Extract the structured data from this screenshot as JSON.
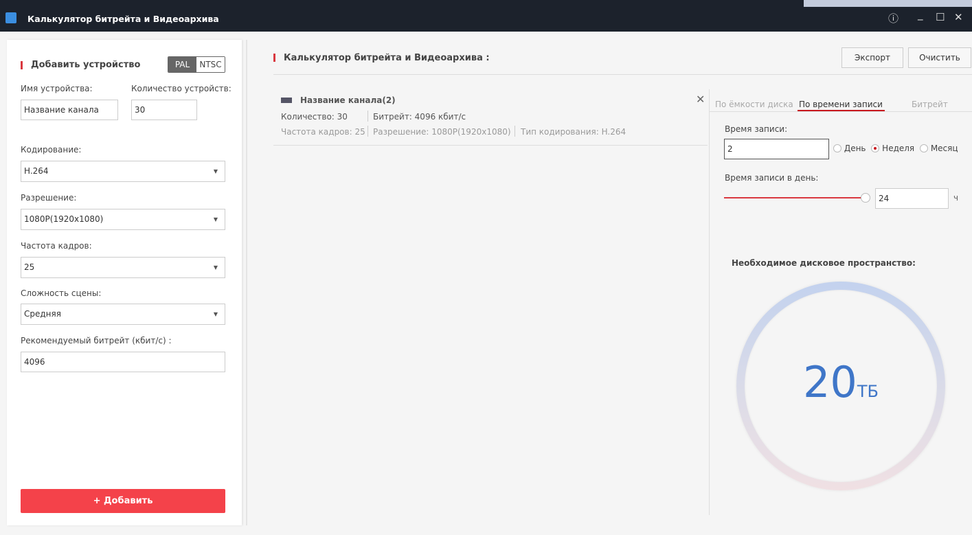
{
  "window": {
    "title": "Калькулятор битрейта и Видеоархива",
    "info_icon": "info-icon",
    "minimize_icon": "minimize-icon",
    "maximize_icon": "maximize-icon",
    "close_icon": "close-icon"
  },
  "left": {
    "title": "Добавить устройство",
    "standard_options": [
      "PAL",
      "NTSC"
    ],
    "standard_selected": "PAL",
    "device_name_label": "Имя устройства:",
    "device_name_value": "Название канала",
    "count_label": "Количество устройств:",
    "count_value": "30",
    "encoding_label": "Кодирование:",
    "encoding_value": "H.264",
    "resolution_label": "Разрешение:",
    "resolution_value": "1080P(1920x1080)",
    "fps_label": "Частота кадров:",
    "fps_value": "25",
    "complexity_label": "Сложность сцены:",
    "complexity_value": "Средняя",
    "bitrate_label": "Рекомендуемый битрейт (кбит/с) :",
    "bitrate_value": "4096",
    "add_button": "+ Добавить"
  },
  "main": {
    "title": "Калькулятор битрейта и Видеоархива :",
    "export_button": "Экспорт",
    "clear_button": "Очистить",
    "channel": {
      "name": "Название канала(2)",
      "count": "Количество: 30",
      "bitrate": "Битрейт: 4096 кбит/с",
      "fps": "Частота кадров: 25",
      "resolution": "Разрешение: 1080P(1920x1080)",
      "encoding": "Тип кодирования: H.264"
    }
  },
  "right": {
    "tabs": [
      "По ёмкости диска",
      "По времени записи",
      "Битрейт"
    ],
    "active_tab": 1,
    "record_time_label": "Время записи:",
    "record_time_value": "2",
    "units": [
      "День",
      "Неделя",
      "Месяц"
    ],
    "unit_selected": "Неделя",
    "per_day_label": "Время записи в день:",
    "per_day_value": "24",
    "per_day_unit": "ч",
    "per_day_fraction": 1.0,
    "result_label": "Необходимое дисковое пространство:",
    "result_value": "20",
    "result_unit": "ТБ"
  },
  "colors": {
    "accent": "#d9383f",
    "add_button": "#f4424a",
    "result": "#3f76c8",
    "titlebar": "#1c222c"
  }
}
